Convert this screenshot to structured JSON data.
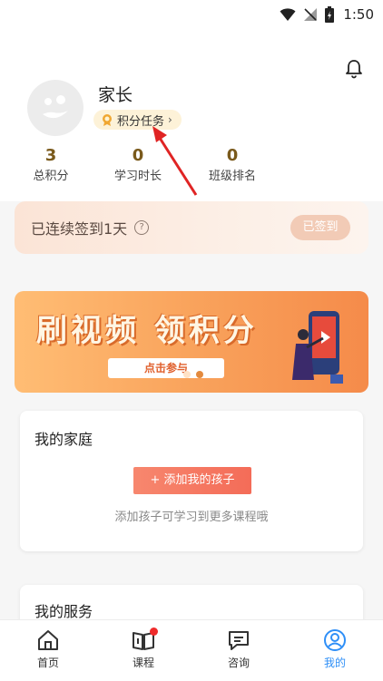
{
  "status_bar": {
    "time": "1:50"
  },
  "profile": {
    "name": "家长",
    "points_task_label": "积分任务",
    "stats": [
      {
        "value": "3",
        "label": "总积分"
      },
      {
        "value": "0",
        "label": "学习时长"
      },
      {
        "value": "0",
        "label": "班级排名"
      }
    ]
  },
  "checkin": {
    "text": "已连续签到1天",
    "button": "已签到"
  },
  "banner": {
    "title": "刷视频 领积分",
    "cta": "点击参与"
  },
  "family": {
    "title": "我的家庭",
    "add_button": "+ 添加我的孩子",
    "hint": "添加孩子可学习到更多课程哦"
  },
  "services": {
    "title": "我的服务"
  },
  "bottom_nav": [
    {
      "label": "首页",
      "icon": "home-icon"
    },
    {
      "label": "课程",
      "icon": "book-icon"
    },
    {
      "label": "咨询",
      "icon": "chat-icon"
    },
    {
      "label": "我的",
      "icon": "user-icon"
    }
  ],
  "colors": {
    "accent": "#2f8ff7",
    "stat_value": "#7a5a1c",
    "add_button": "#f46c58",
    "banner": "#f9a35c"
  }
}
